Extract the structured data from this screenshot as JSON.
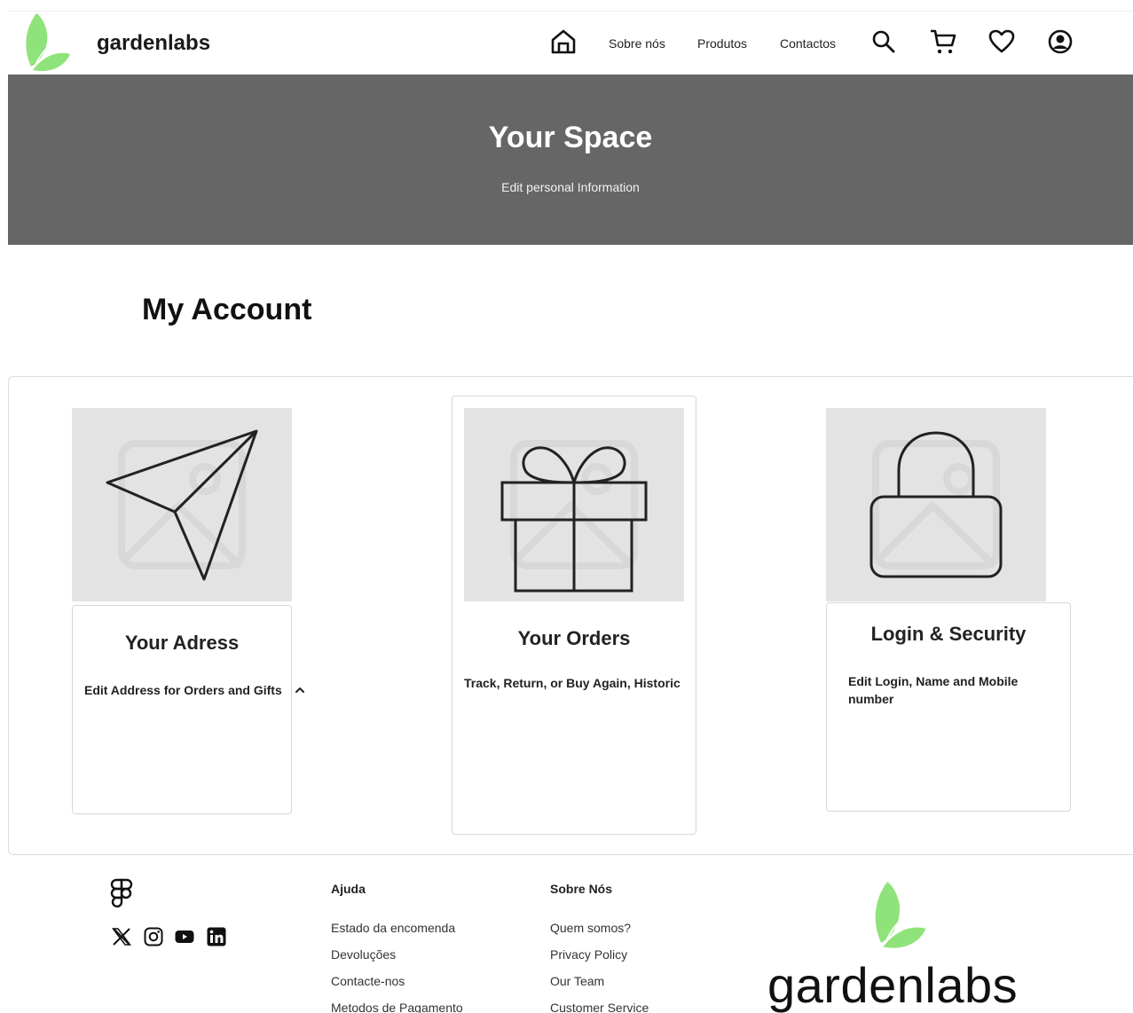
{
  "header": {
    "brand": "gardenlabs",
    "nav": [
      "Sobre nós",
      "Produtos",
      "Contactos"
    ],
    "icons": [
      "home-icon",
      "search-icon",
      "cart-icon",
      "heart-icon",
      "user-icon"
    ]
  },
  "hero": {
    "title": "Your Space",
    "subtitle": "Edit personal Information"
  },
  "main": {
    "title": "My Account",
    "cards": [
      {
        "icon": "send-icon",
        "title": "Your Adress",
        "desc": "Edit Address for Orders and Gifts"
      },
      {
        "icon": "gift-icon",
        "title": "Your Orders",
        "desc": "Track, Return, or Buy Again, Historic"
      },
      {
        "icon": "lock-icon",
        "title": "Login & Security",
        "desc": "Edit Login, Name and Mobile number"
      }
    ]
  },
  "footer": {
    "social": [
      "x-icon",
      "instagram-icon",
      "youtube-icon",
      "linkedin-icon"
    ],
    "ajuda": {
      "title": "Ajuda",
      "links": [
        "Estado da encomenda",
        "Devoluções",
        "Contacte-nos",
        "Metodos de Pagamento"
      ]
    },
    "sobre": {
      "title": "Sobre Nós",
      "links": [
        "Quem somos?",
        "Privacy Policy",
        "Our Team",
        "Customer Service"
      ]
    },
    "brand": "gardenlabs"
  },
  "colors": {
    "leaf": "#8fe37a",
    "hero_bg": "#666666",
    "image_bg": "#e3e3e3"
  }
}
